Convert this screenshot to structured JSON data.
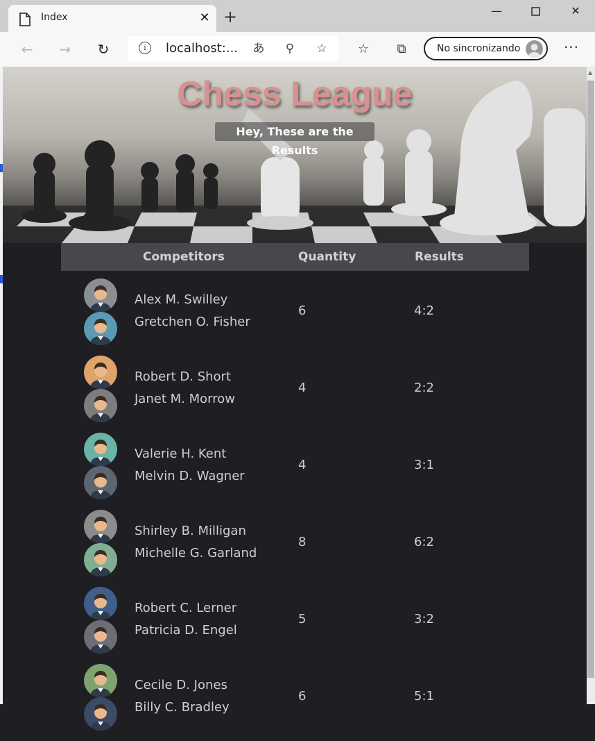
{
  "browser": {
    "tab_title": "Index",
    "address": "localhost:...",
    "sync_label": "No sincronizando"
  },
  "hero": {
    "title": "Chess League",
    "subtitle": "Hey, These are the Results"
  },
  "table": {
    "headers": [
      "Competitors",
      "Quantity",
      "Results"
    ],
    "rows": [
      {
        "p1": "Alex M. Swilley",
        "p2": "Gretchen O. Fisher",
        "quantity": "6",
        "result": "4:2"
      },
      {
        "p1": "Robert D. Short",
        "p2": "Janet M. Morrow",
        "quantity": "4",
        "result": "2:2"
      },
      {
        "p1": "Valerie H. Kent",
        "p2": "Melvin D. Wagner",
        "quantity": "4",
        "result": "3:1"
      },
      {
        "p1": "Shirley B. Milligan",
        "p2": "Michelle G. Garland",
        "quantity": "8",
        "result": "6:2"
      },
      {
        "p1": "Robert C. Lerner",
        "p2": "Patricia D. Engel",
        "quantity": "5",
        "result": "3:2"
      },
      {
        "p1": "Cecile D. Jones",
        "p2": "Billy C. Bradley",
        "quantity": "6",
        "result": "5:1"
      }
    ]
  },
  "avatars": [
    [
      "#8a8f93",
      "#5a9ab5"
    ],
    [
      "#e0a46a",
      "#7d7d7d"
    ],
    [
      "#6ab3a8",
      "#5c6670"
    ],
    [
      "#8c8c8c",
      "#7fae93"
    ],
    [
      "#3f5f8a",
      "#6d6d75"
    ],
    [
      "#7fa36f",
      "#3b4a66"
    ]
  ]
}
